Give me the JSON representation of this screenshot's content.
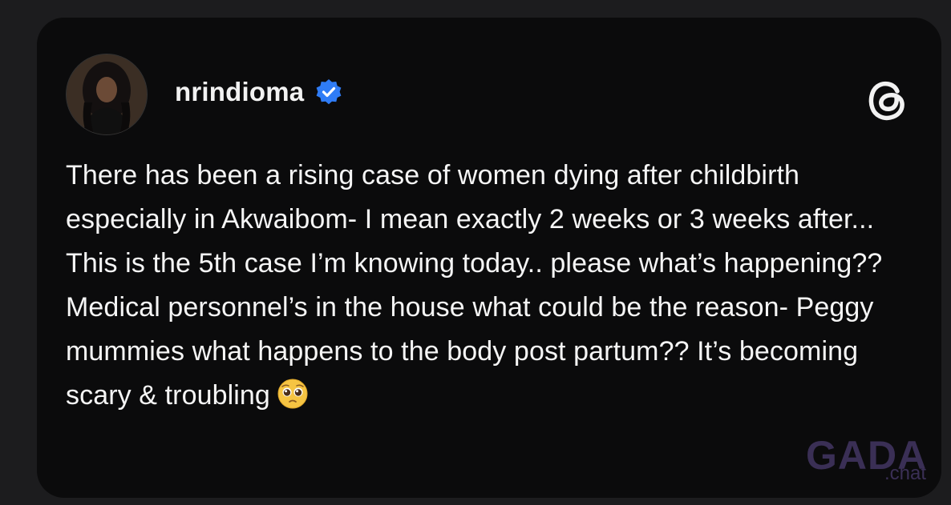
{
  "post": {
    "username": "nrindioma",
    "verified": true,
    "text": "There has been a rising case of women dying after childbirth especially in Akwaibom- I mean exactly 2 weeks or 3 weeks after... This is the 5th case I’m knowing today.. please what’s happening?? Medical personnel’s in the house what could be the reason- Peggy mummies what happens to the body post partum?? It’s becoming scary & troubling",
    "emoji": "pleading-face-emoji"
  },
  "icons": {
    "verified": "verified-badge-icon",
    "platform": "threads-logo-icon"
  },
  "watermark": {
    "main": "GADA",
    "sub": ".chat"
  },
  "colors": {
    "background": "#1c1c1e",
    "card": "#0b0b0c",
    "text": "#f5f5f5",
    "verified": "#2f7cf6",
    "watermark": "#3a2f55"
  }
}
